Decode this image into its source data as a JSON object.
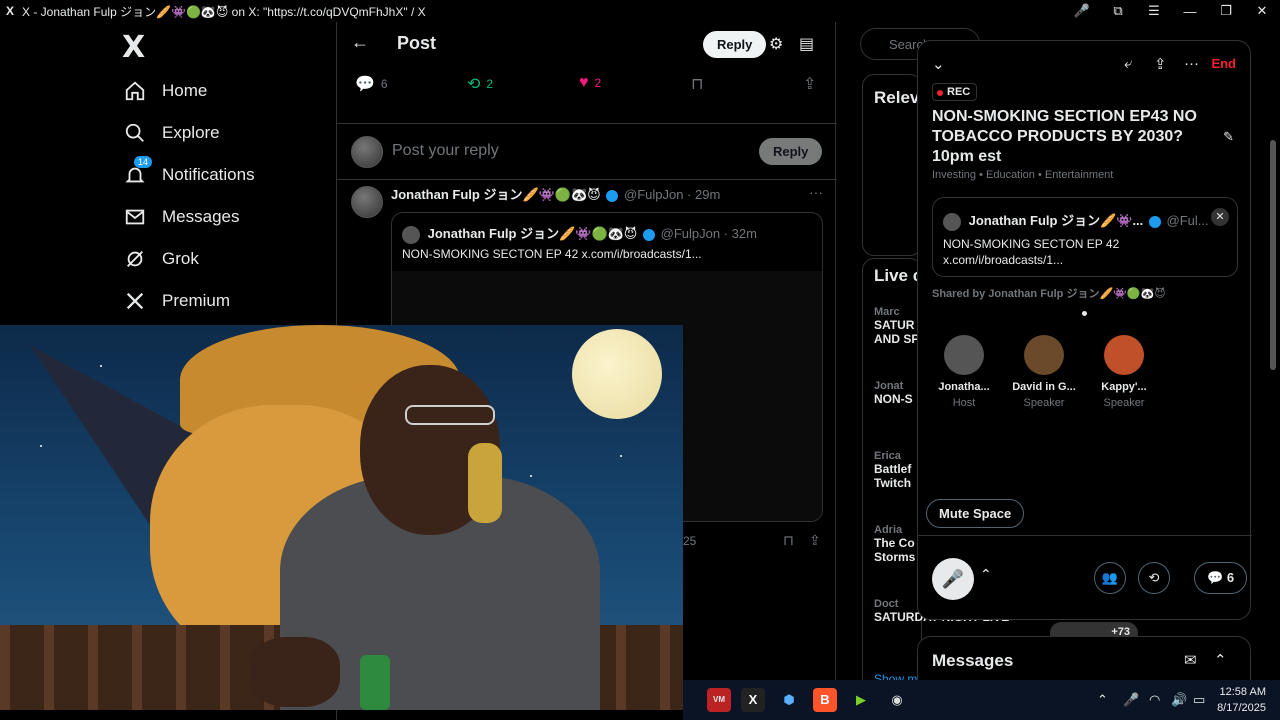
{
  "browser": {
    "logo": "X",
    "title": "X - Jonathan Fulp ジョン🥖👾🟢🐼😈 on X: \"https://t.co/qDVQmFhJhX\" / X",
    "controls": [
      "🎤",
      "⧉",
      "☰",
      "—",
      "❐",
      "✕"
    ]
  },
  "nav": {
    "logo": "X",
    "items": [
      {
        "label": "Home",
        "icon": "home-icon"
      },
      {
        "label": "Explore",
        "icon": "search-icon"
      },
      {
        "label": "Notifications",
        "icon": "bell-icon",
        "badge": "14"
      },
      {
        "label": "Messages",
        "icon": "mail-icon"
      },
      {
        "label": "Grok",
        "icon": "grok-icon"
      },
      {
        "label": "Premium",
        "icon": "x-icon"
      }
    ]
  },
  "post": {
    "title": "Post",
    "reply_button": "Reply",
    "actions": {
      "replies": "6",
      "reposts": "2",
      "likes": "2"
    },
    "reply_placeholder": "Post your reply",
    "reply_submit": "Reply",
    "tweet": {
      "author": "Jonathan Fulp ジョン🥖👾🟢🐼😈",
      "handle": "@FulpJon · 29m",
      "quote": {
        "author": "Jonathan Fulp ジョン🥖👾🟢🐼😈",
        "handle": "@FulpJon · 32m",
        "text": "NON-SMOKING SECTON EP 42 x.com/i/broadcasts/1..."
      },
      "views": "25"
    }
  },
  "right": {
    "search_placeholder": "Search",
    "relevant_title": "Relev",
    "live_title": "Live c",
    "live_items": [
      {
        "host": "Marc",
        "title": "SATUR",
        "sub": "AND SP"
      },
      {
        "host": "Jonat",
        "title": "NON-S"
      },
      {
        "host": "Erica",
        "title": "Battlef",
        "sub": "Twitch"
      },
      {
        "host": "Adria",
        "title": "The Co",
        "sub": "Storms"
      },
      {
        "host": "Doct",
        "title": "SATURDAY NIGHT LIVE",
        "count": "+73"
      }
    ],
    "show_more": "Show m"
  },
  "space": {
    "end_label": "End",
    "rec_label": "REC",
    "title": "NON-SMOKING SECTION EP43 NO TOBACCO PRODUCTS BY 2030? 10pm est",
    "topics": "Investing • Education • Entertainment",
    "shared_post": {
      "author": "Jonathan Fulp ジョン🥖👾...",
      "handle": "@Ful...",
      "text": "NON-SMOKING SECTON EP 42 x.com/i/broadcasts/1..."
    },
    "shared_by": "Shared by Jonathan Fulp ジョン🥖👾🟢🐼😈",
    "participants": [
      {
        "name": "Jonatha...",
        "role": "Host",
        "color": "#555"
      },
      {
        "name": "David in G...",
        "role": "Speaker",
        "color": "#6a4a2a"
      },
      {
        "name": "Kappy'...",
        "role": "Speaker",
        "color": "#c0502a"
      }
    ],
    "mute_label": "Mute Space",
    "comments_count": "6"
  },
  "messages": {
    "title": "Messages"
  },
  "taskbar": {
    "time": "12:58 AM",
    "date": "8/17/2025",
    "x_badge": "14"
  }
}
